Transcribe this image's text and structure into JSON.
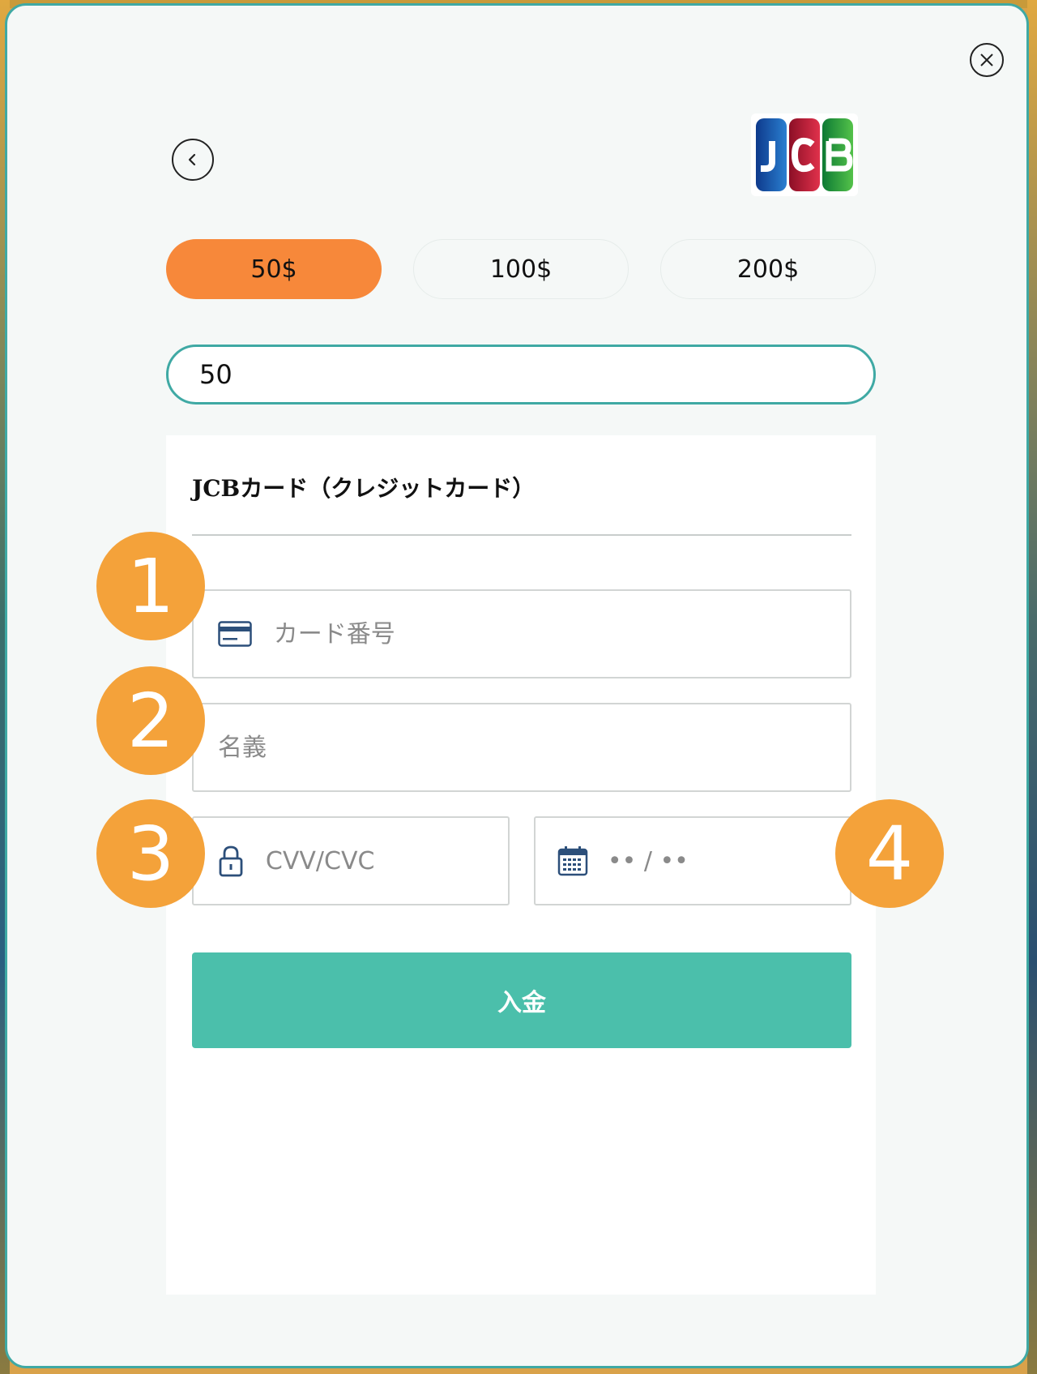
{
  "amounts": {
    "options": [
      {
        "label": "50$",
        "active": true
      },
      {
        "label": "100$",
        "active": false
      },
      {
        "label": "200$",
        "active": false
      }
    ],
    "input_value": "50"
  },
  "form": {
    "title": "JCBカード（クレジットカード）",
    "card_number_placeholder": "カード番号",
    "name_placeholder": "名義",
    "cvv_placeholder": "CVV/CVC",
    "expiry_placeholder": "•• / ••",
    "submit_label": "入金"
  },
  "badges": [
    "1",
    "2",
    "3",
    "4"
  ],
  "colors": {
    "accent_teal": "#3fa9a4",
    "submit": "#4bbfab",
    "active_amount": "#f7883a",
    "badge": "#f4a23a"
  },
  "icons": [
    "close-icon",
    "chevron-left-icon",
    "jcb-logo",
    "credit-card-icon",
    "lock-icon",
    "calendar-icon"
  ]
}
